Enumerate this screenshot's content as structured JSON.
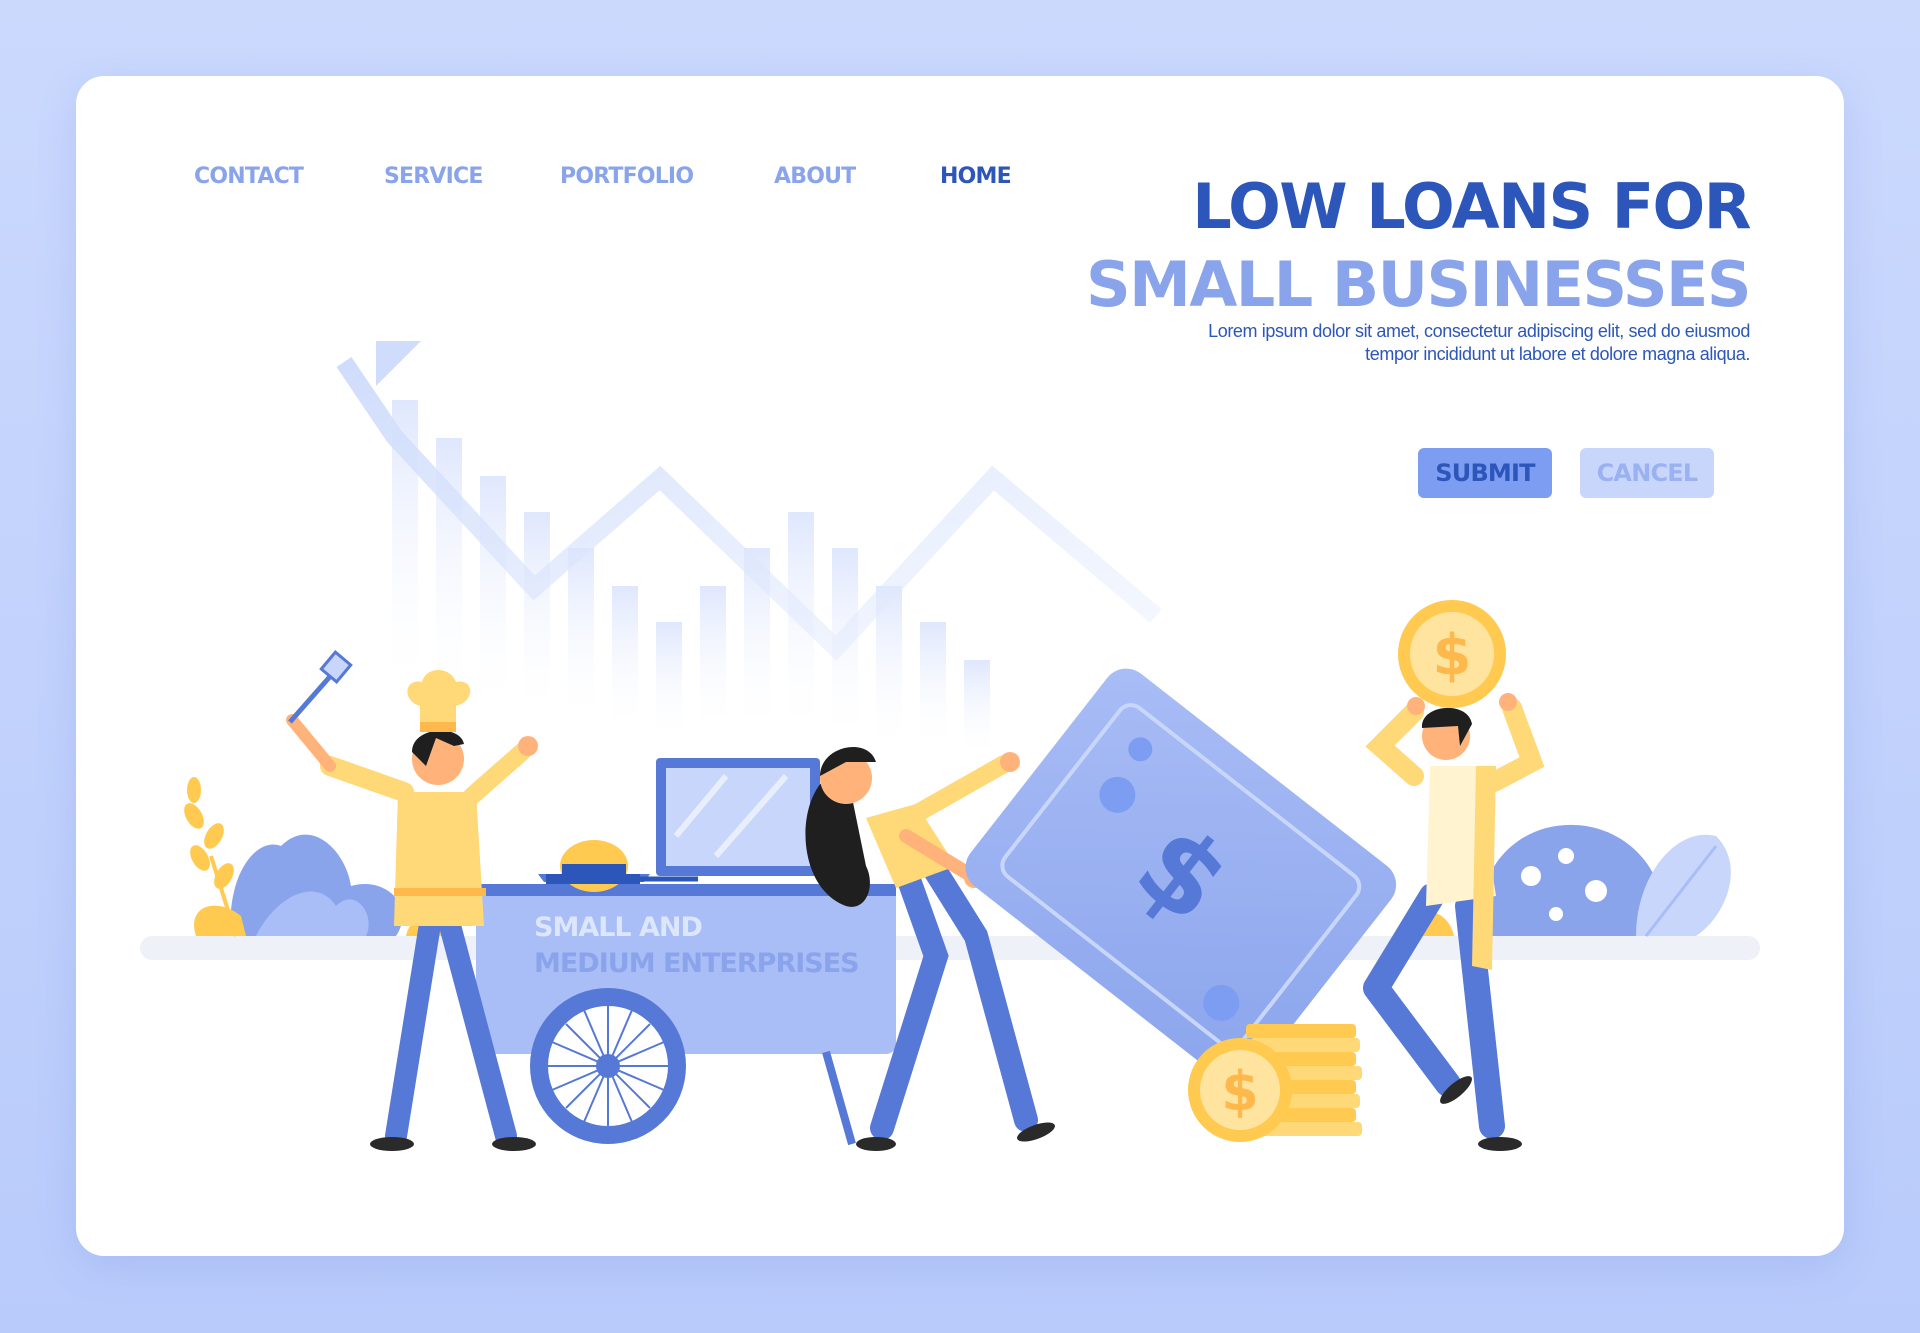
{
  "nav": {
    "items": [
      {
        "label": "CONTACT"
      },
      {
        "label": "SERVICE"
      },
      {
        "label": "PORTFOLIO"
      },
      {
        "label": "ABOUT"
      },
      {
        "label": "HOME",
        "active": true
      }
    ]
  },
  "hero": {
    "title_line1": "LOW LOANS FOR",
    "title_line2": "SMALL BUSINESSES",
    "description_line1": "Lorem ipsum dolor sit amet, consectetur adipiscing elit, sed do eiusmod",
    "description_line2": "tempor incididunt ut labore et dolore magna aliqua."
  },
  "buttons": {
    "submit": "SUBMIT",
    "cancel": "CANCEL"
  },
  "illustration": {
    "cart_sign_line1": "SMALL AND",
    "cart_sign_line2": "MEDIUM ENTERPRISES",
    "coin_symbol": "$",
    "banknote_symbol": "$"
  },
  "colors": {
    "page_background": "#c3d3fc",
    "primary": "#2c56b9",
    "accent": "#8aa4ec",
    "yellow": "#ffd878",
    "coin": "#ffca4f"
  }
}
